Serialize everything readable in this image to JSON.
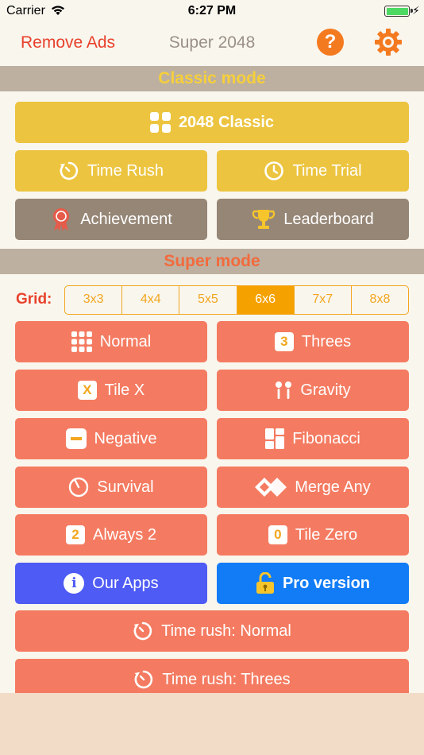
{
  "status_bar": {
    "carrier": "Carrier",
    "time": "6:27 PM"
  },
  "nav": {
    "remove_ads": "Remove Ads",
    "title": "Super 2048",
    "help_glyph": "?"
  },
  "classic_section": {
    "title": "Classic mode",
    "classic_button": "2048 Classic",
    "time_rush": "Time Rush",
    "time_trial": "Time Trial",
    "achievement": "Achievement",
    "leaderboard": "Leaderboard"
  },
  "super_section": {
    "title": "Super mode",
    "grid_label": "Grid:",
    "grid_options": [
      "3x3",
      "4x4",
      "5x5",
      "6x6",
      "7x7",
      "8x8"
    ],
    "grid_selected": "6x6",
    "modes": {
      "normal": "Normal",
      "threes": "Threes",
      "tile_x": "Tile X",
      "gravity": "Gravity",
      "negative": "Negative",
      "fibonacci": "Fibonacci",
      "survival": "Survival",
      "merge_any": "Merge Any",
      "always_2": "Always 2",
      "tile_zero": "Tile Zero",
      "our_apps": "Our Apps",
      "pro_version": "Pro version",
      "time_rush_normal": "Time rush: Normal",
      "time_rush_threes": "Time rush: Threes"
    },
    "badges": {
      "threes": "3",
      "tile_x": "X",
      "always_2": "2",
      "tile_zero": "0",
      "info": "i"
    }
  },
  "colors": {
    "accent_red": "#e8412b",
    "classic_yellow": "#ecc43f",
    "brown": "#968676",
    "coral": "#f47b61",
    "purple": "#4e5bf4",
    "blue": "#117cf6",
    "orange": "#f5a200",
    "section_bar": "#bdb0a0"
  },
  "icons": {
    "help": "question-circle-icon",
    "settings": "gear-icon",
    "classic": "grid-2x2-icon",
    "time_rush": "refresh-timer-icon",
    "time_trial": "clock-icon",
    "achievement": "medal-icon",
    "leaderboard": "trophy-icon",
    "normal": "grid-3x3-icon",
    "gravity": "gravity-icon",
    "negative": "minus-box-icon",
    "fibonacci": "fibonacci-tiles-icon",
    "survival": "gauge-icon",
    "merge_any": "diamonds-icon",
    "our_apps": "info-icon",
    "pro": "unlock-icon"
  }
}
